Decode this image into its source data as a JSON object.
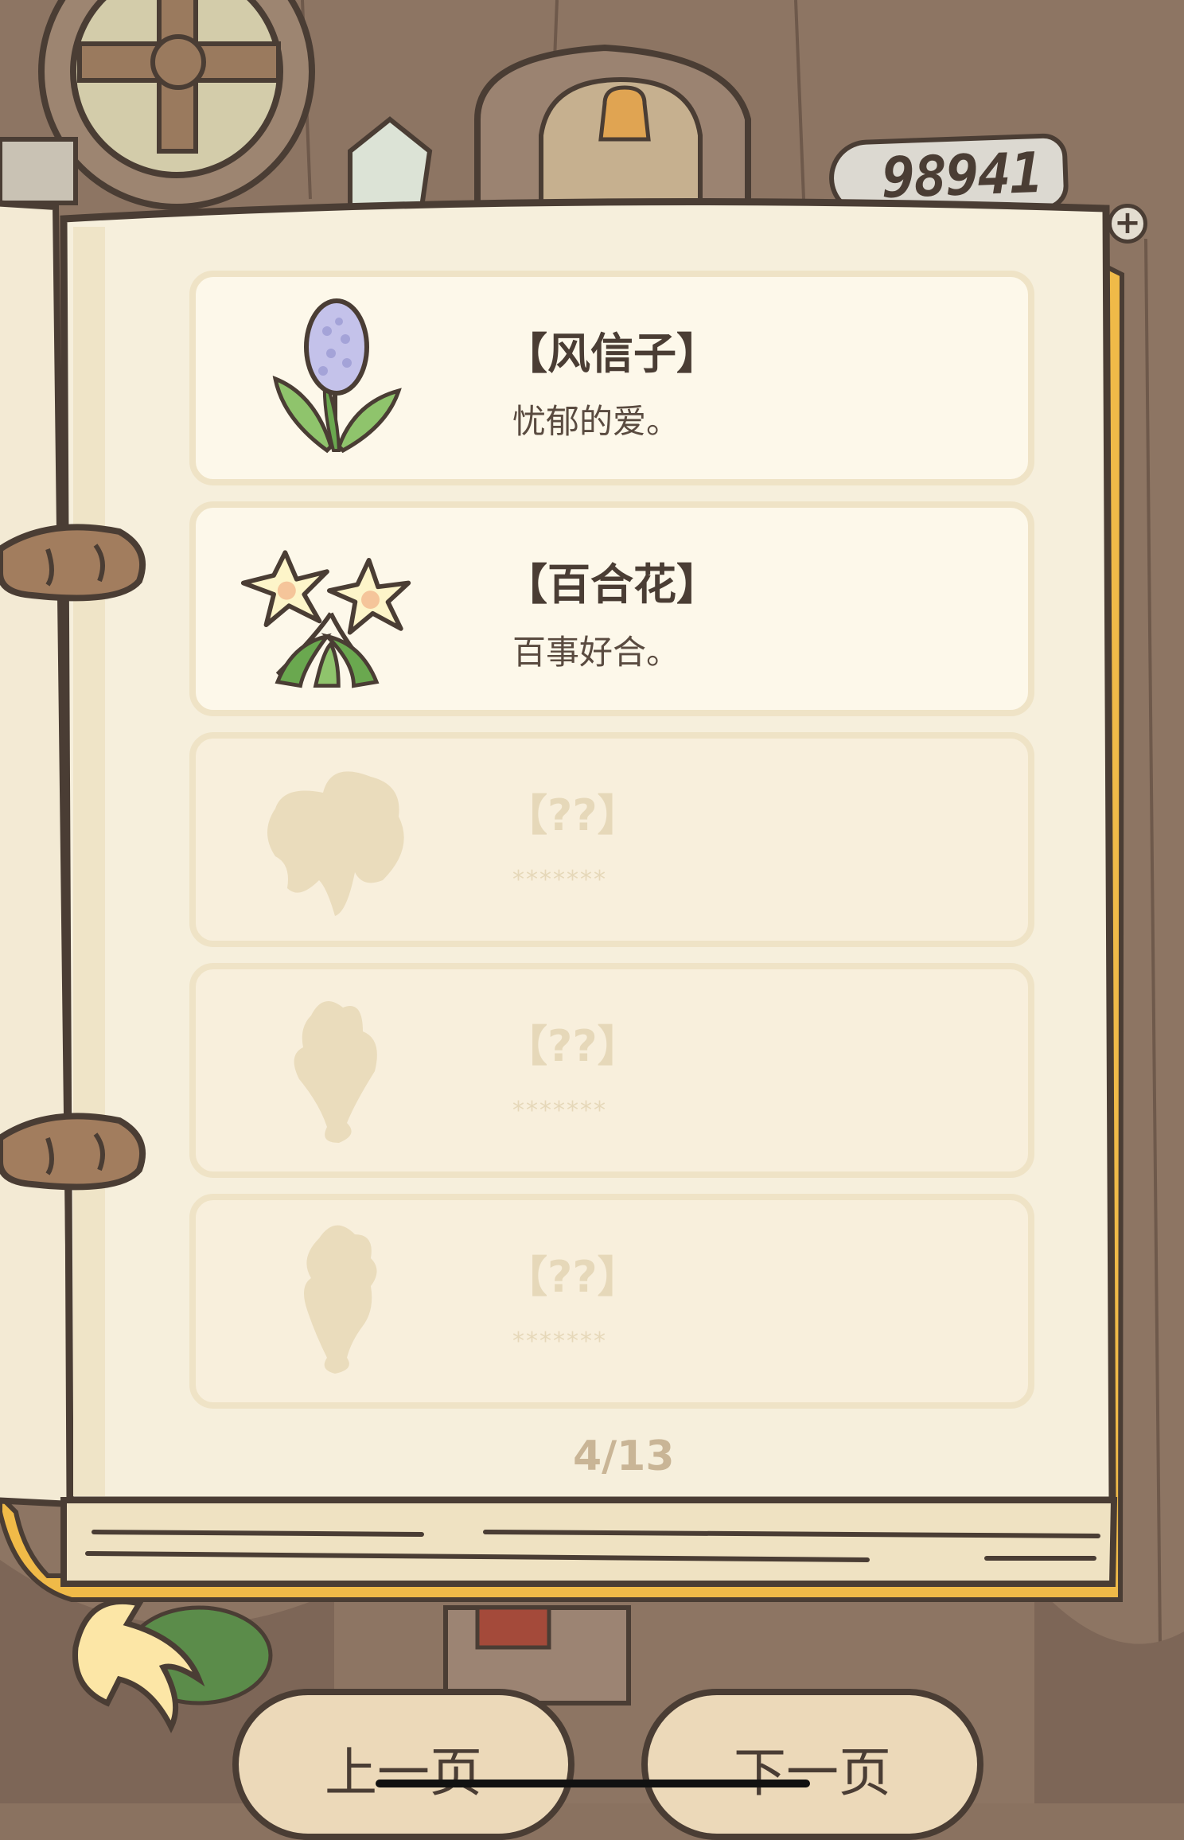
{
  "currency": {
    "amount": "98941",
    "plus_label": "+"
  },
  "flowers": [
    {
      "name": "【风信子】",
      "desc": "忧郁的爱。",
      "icon": "hyacinth-icon",
      "locked": false
    },
    {
      "name": "【百合花】",
      "desc": "百事好合。",
      "icon": "lily-icon",
      "locked": false
    },
    {
      "name": "【??】",
      "desc": "*******",
      "icon": "unknown-flower-silhouette-icon",
      "locked": true
    },
    {
      "name": "【??】",
      "desc": "*******",
      "icon": "unknown-flower-silhouette-icon",
      "locked": true
    },
    {
      "name": "【??】",
      "desc": "*******",
      "icon": "unknown-flower-silhouette-icon",
      "locked": true
    }
  ],
  "pagination": {
    "text": "4/13"
  },
  "nav": {
    "prev_label": "上一页",
    "next_label": "下一页"
  },
  "colors": {
    "outline": "#4a3d34",
    "page": "#f6efdc",
    "card": "#fdf8ea",
    "locked_text": "#e6d8b9"
  }
}
